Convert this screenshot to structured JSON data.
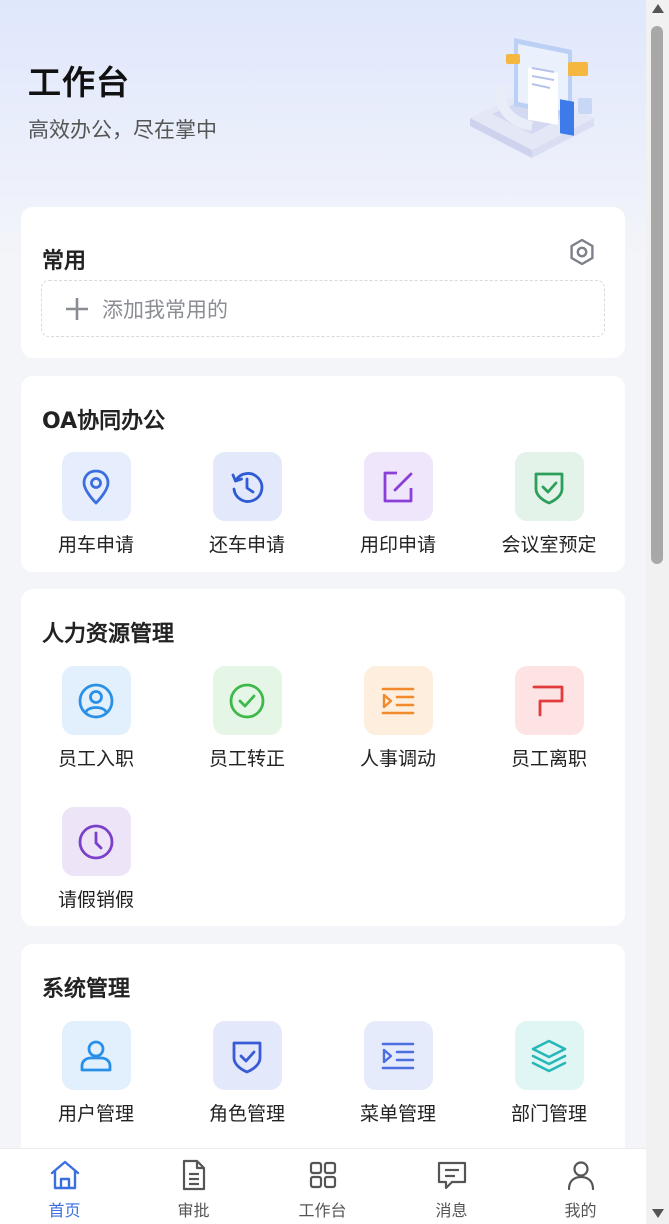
{
  "header": {
    "title": "工作台",
    "subtitle": "高效办公，尽在掌中"
  },
  "favorites": {
    "title": "常用",
    "add_label": "添加我常用的"
  },
  "sections": [
    {
      "title": "OA协同办公",
      "items": [
        {
          "label": "用车申请",
          "icon": "location-pin-icon",
          "color": "#3b6fe0",
          "bg": "#e6edfc"
        },
        {
          "label": "还车申请",
          "icon": "history-icon",
          "color": "#2f5bd3",
          "bg": "#e3e9fb"
        },
        {
          "label": "用印申请",
          "icon": "edit-icon",
          "color": "#8a3fd9",
          "bg": "#f0e6fb"
        },
        {
          "label": "会议室预定",
          "icon": "shield-check-icon",
          "color": "#2e9e5b",
          "bg": "#e3f3e9"
        }
      ]
    },
    {
      "title": "人力资源管理",
      "items": [
        {
          "label": "员工入职",
          "icon": "user-circle-icon",
          "color": "#2a8fe6",
          "bg": "#e2f0fd"
        },
        {
          "label": "员工转正",
          "icon": "check-circle-icon",
          "color": "#3eb84a",
          "bg": "#e5f6e6"
        },
        {
          "label": "人事调动",
          "icon": "indent-icon",
          "color": "#f08a2c",
          "bg": "#fdeedd"
        },
        {
          "label": "员工离职",
          "icon": "exit-icon",
          "color": "#e23b3b",
          "bg": "#fde3e3"
        },
        {
          "label": "请假销假",
          "icon": "clock-icon",
          "color": "#7b3fc9",
          "bg": "#ede4f8"
        }
      ]
    },
    {
      "title": "系统管理",
      "items": [
        {
          "label": "用户管理",
          "icon": "user-icon",
          "color": "#2a8fe6",
          "bg": "#e2f0fd"
        },
        {
          "label": "角色管理",
          "icon": "shield-check-icon",
          "color": "#3a5bd6",
          "bg": "#e3e8fb"
        },
        {
          "label": "菜单管理",
          "icon": "indent-icon",
          "color": "#4c6fe0",
          "bg": "#e6ebfb"
        },
        {
          "label": "部门管理",
          "icon": "layers-icon",
          "color": "#26b8b8",
          "bg": "#e0f6f5"
        }
      ]
    }
  ],
  "tabbar": [
    {
      "label": "首页",
      "icon": "home-icon",
      "active": true
    },
    {
      "label": "审批",
      "icon": "document-icon",
      "active": false
    },
    {
      "label": "工作台",
      "icon": "grid-icon",
      "active": false
    },
    {
      "label": "消息",
      "icon": "message-icon",
      "active": false
    },
    {
      "label": "我的",
      "icon": "person-icon",
      "active": false
    }
  ],
  "colors": {
    "accent": "#3b6fe0",
    "tab_inactive": "#555555"
  }
}
